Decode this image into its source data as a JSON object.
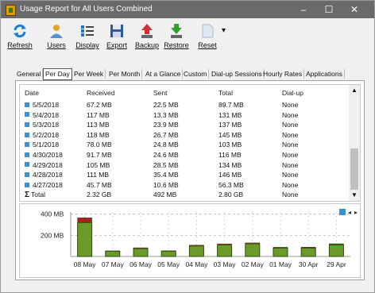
{
  "window": {
    "title": "Usage Report for All Users Combined",
    "minimize": "–",
    "maximize": "☐",
    "close": "✕"
  },
  "toolbar": {
    "buttons": [
      {
        "label": "Refresh",
        "icon": "refresh-icon",
        "color": "#1a7fd4"
      },
      {
        "label": "Users",
        "icon": "users-icon",
        "color": "#e8a030"
      },
      {
        "label": "Display",
        "icon": "display-icon",
        "color": "#2a70c8"
      },
      {
        "label": "Export",
        "icon": "export-icon",
        "color": "#2a5aa0"
      },
      {
        "label": "Backup",
        "icon": "backup-icon",
        "color": "#d03030"
      },
      {
        "label": "Restore",
        "icon": "restore-icon",
        "color": "#30a030"
      },
      {
        "label": "Reset",
        "icon": "reset-icon",
        "color": "#dfe9f5"
      }
    ],
    "dropdown": "▾"
  },
  "tabs": [
    "General",
    "Per Day",
    "Per Week",
    "Per Month",
    "At a Glance",
    "Custom",
    "Dial-up Sessions",
    "Hourly Rates",
    "Applications"
  ],
  "active_tab": "Per Day",
  "table": {
    "headers": [
      "Date",
      "Received",
      "Sent",
      "Total",
      "Dial-up"
    ],
    "rows": [
      [
        "5/5/2018",
        "67.2 MB",
        "22.5 MB",
        "89.7 MB",
        "None"
      ],
      [
        "5/4/2018",
        "117 MB",
        "13.3 MB",
        "131 MB",
        "None"
      ],
      [
        "5/3/2018",
        "113 MB",
        "23.9 MB",
        "137 MB",
        "None"
      ],
      [
        "5/2/2018",
        "118 MB",
        "26.7 MB",
        "145 MB",
        "None"
      ],
      [
        "5/1/2018",
        "78.0 MB",
        "24.8 MB",
        "103 MB",
        "None"
      ],
      [
        "4/30/2018",
        "91.7 MB",
        "24.6 MB",
        "116 MB",
        "None"
      ],
      [
        "4/29/2018",
        "105 MB",
        "28.5 MB",
        "134 MB",
        "None"
      ],
      [
        "4/28/2018",
        "111 MB",
        "35.4 MB",
        "146 MB",
        "None"
      ],
      [
        "4/27/2018",
        "45.7 MB",
        "10.6 MB",
        "56.3 MB",
        "None"
      ]
    ],
    "total": [
      "Total",
      "2.32 GB",
      "492 MB",
      "2.80 GB",
      "None"
    ]
  },
  "chart_data": {
    "type": "bar",
    "categories": [
      "08 May",
      "07 May",
      "06 May",
      "05 May",
      "04 May",
      "03 May",
      "02 May",
      "01 May",
      "30 Apr",
      "29 Apr"
    ],
    "series": [
      {
        "values": [
          45,
          3,
          7,
          4,
          7,
          9,
          8,
          7,
          8,
          10
        ]
      },
      {
        "values": [
          320,
          50,
          75,
          50,
          100,
          110,
          120,
          80,
          80,
          110
        ]
      }
    ],
    "yticks": [
      "400 MB",
      "200 MB"
    ],
    "ylim": [
      0,
      420
    ],
    "colors": {
      "sent": "#a82020",
      "received": "#6a9a2a",
      "outline": "#2e4a14"
    },
    "legend_icons": [
      "bar-chart-icon",
      "chevron-left-icon",
      "chevron-right-icon"
    ]
  }
}
